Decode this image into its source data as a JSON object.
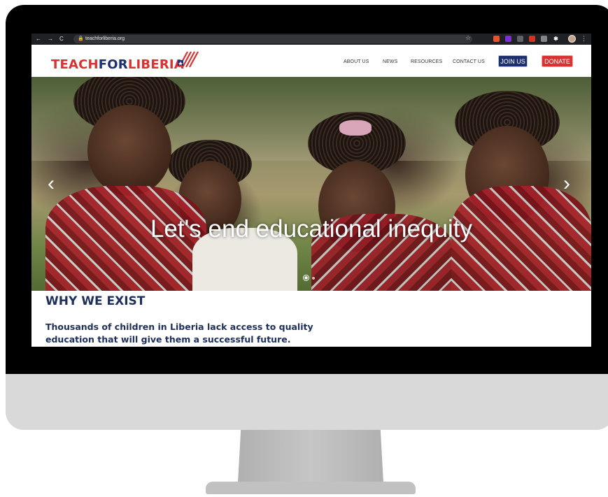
{
  "browser": {
    "back_icon": "←",
    "forward_icon": "→",
    "reload_icon": "C",
    "url": "teachforliberia.org",
    "star_icon": "☆",
    "menu_icon": "⋮"
  },
  "site": {
    "logo": {
      "teach": "TEACH",
      "for": "FOR",
      "liberia": "LIBERIA"
    },
    "nav": [
      {
        "label": "ABOUT US"
      },
      {
        "label": "NEWS"
      },
      {
        "label": "RESOURCES"
      },
      {
        "label": "CONTACT US"
      }
    ],
    "join_label": "JOIN US",
    "donate_label": "DONATE"
  },
  "hero": {
    "title": "Let's end educational inequity",
    "prev_icon": "‹",
    "next_icon": "›",
    "slide_count": 3,
    "active_slide": 1
  },
  "why": {
    "heading": "WHY WE EXIST",
    "body": "Thousands of children in Liberia lack access to quality education that will give them a successful future."
  },
  "colors": {
    "brand_red": "#d83232",
    "brand_blue": "#1d2f6f",
    "heading_navy": "#1d2f5a"
  }
}
